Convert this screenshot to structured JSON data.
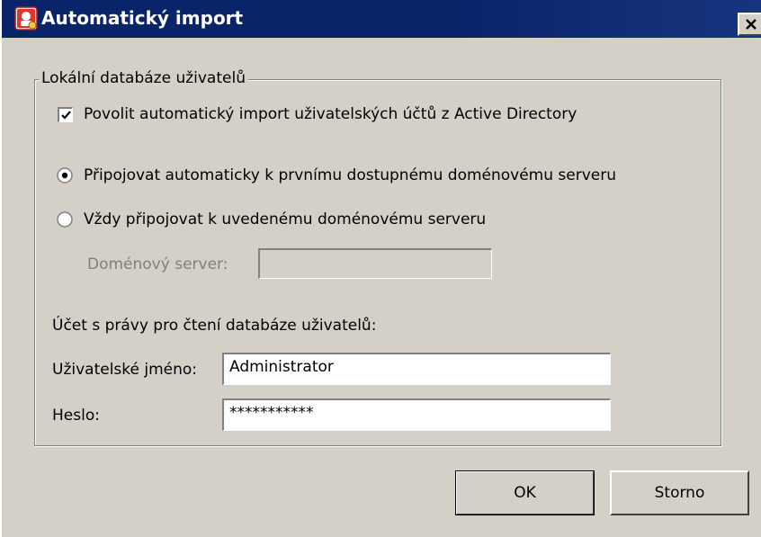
{
  "window": {
    "title": "Automatický import",
    "close_glyph": "✕"
  },
  "group": {
    "legend": "Lokální databáze uživatelů",
    "enable_import": {
      "label": "Povolit automatický import uživatelských účtů z Active Directory",
      "checked": true
    },
    "radio_auto": {
      "label": "Připojovat automaticky k prvnímu dostupnému doménovému serveru",
      "selected": true
    },
    "radio_specific": {
      "label": "Vždy připojovat k uvedenému doménovému serveru",
      "selected": false
    },
    "domain_server": {
      "label": "Doménový server:",
      "value": ""
    },
    "account_heading": "Účet s právy pro čtení databáze uživatelů:",
    "username": {
      "label": "Uživatelské jméno:",
      "value": "Administrator"
    },
    "password": {
      "label": "Heslo:",
      "value": "***********"
    }
  },
  "buttons": {
    "ok": "OK",
    "cancel": "Storno"
  },
  "colors": {
    "titlebar": "#0a246a",
    "dialog_bg": "#d4d0c8",
    "disabled_text": "#808080"
  }
}
